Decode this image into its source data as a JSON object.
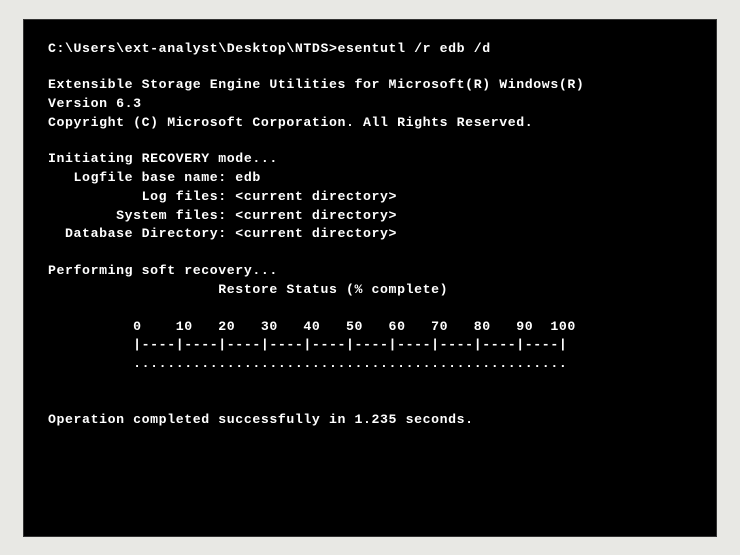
{
  "prompt": "C:\\Users\\ext-analyst\\Desktop\\NTDS>",
  "command": "esentutl /r edb /d",
  "header": {
    "title": "Extensible Storage Engine Utilities for Microsoft(R) Windows(R)",
    "version": "Version 6.3",
    "copyright": "Copyright (C) Microsoft Corporation. All Rights Reserved."
  },
  "recovery": {
    "mode_line": "Initiating RECOVERY mode...",
    "logfile_base": "   Logfile base name: edb",
    "log_files": "           Log files: <current directory>",
    "system_files": "        System files: <current directory>",
    "db_dir": "  Database Directory: <current directory>"
  },
  "progress": {
    "performing": "Performing soft recovery...",
    "status_label": "                    Restore Status (% complete)",
    "scale": "          0    10   20   30   40   50   60   70   80   90  100",
    "ruler": "          |----|----|----|----|----|----|----|----|----|----|",
    "dots": "          ..................................................."
  },
  "result": "Operation completed successfully in 1.235 seconds."
}
